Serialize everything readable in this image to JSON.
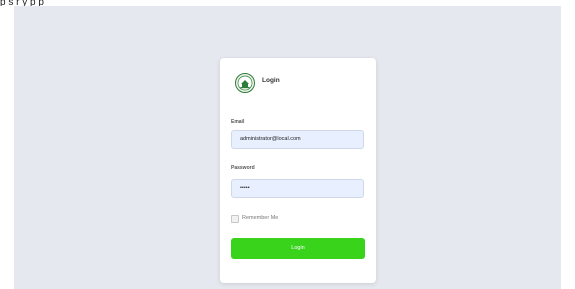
{
  "top_bar": {
    "text": "p s r y  p p"
  },
  "brand": {
    "title": "Login",
    "logo_icon": "seal-logo"
  },
  "form": {
    "email": {
      "label": "Email",
      "value": "administrator@local.com"
    },
    "password": {
      "label": "Password",
      "value": "•••••"
    },
    "remember": {
      "label": "Remember Me",
      "checked": false
    },
    "submit_label": "Login"
  },
  "colors": {
    "page_bg": "#e5e8ef",
    "button": "#39d31c",
    "input_bg": "#e8efff"
  }
}
